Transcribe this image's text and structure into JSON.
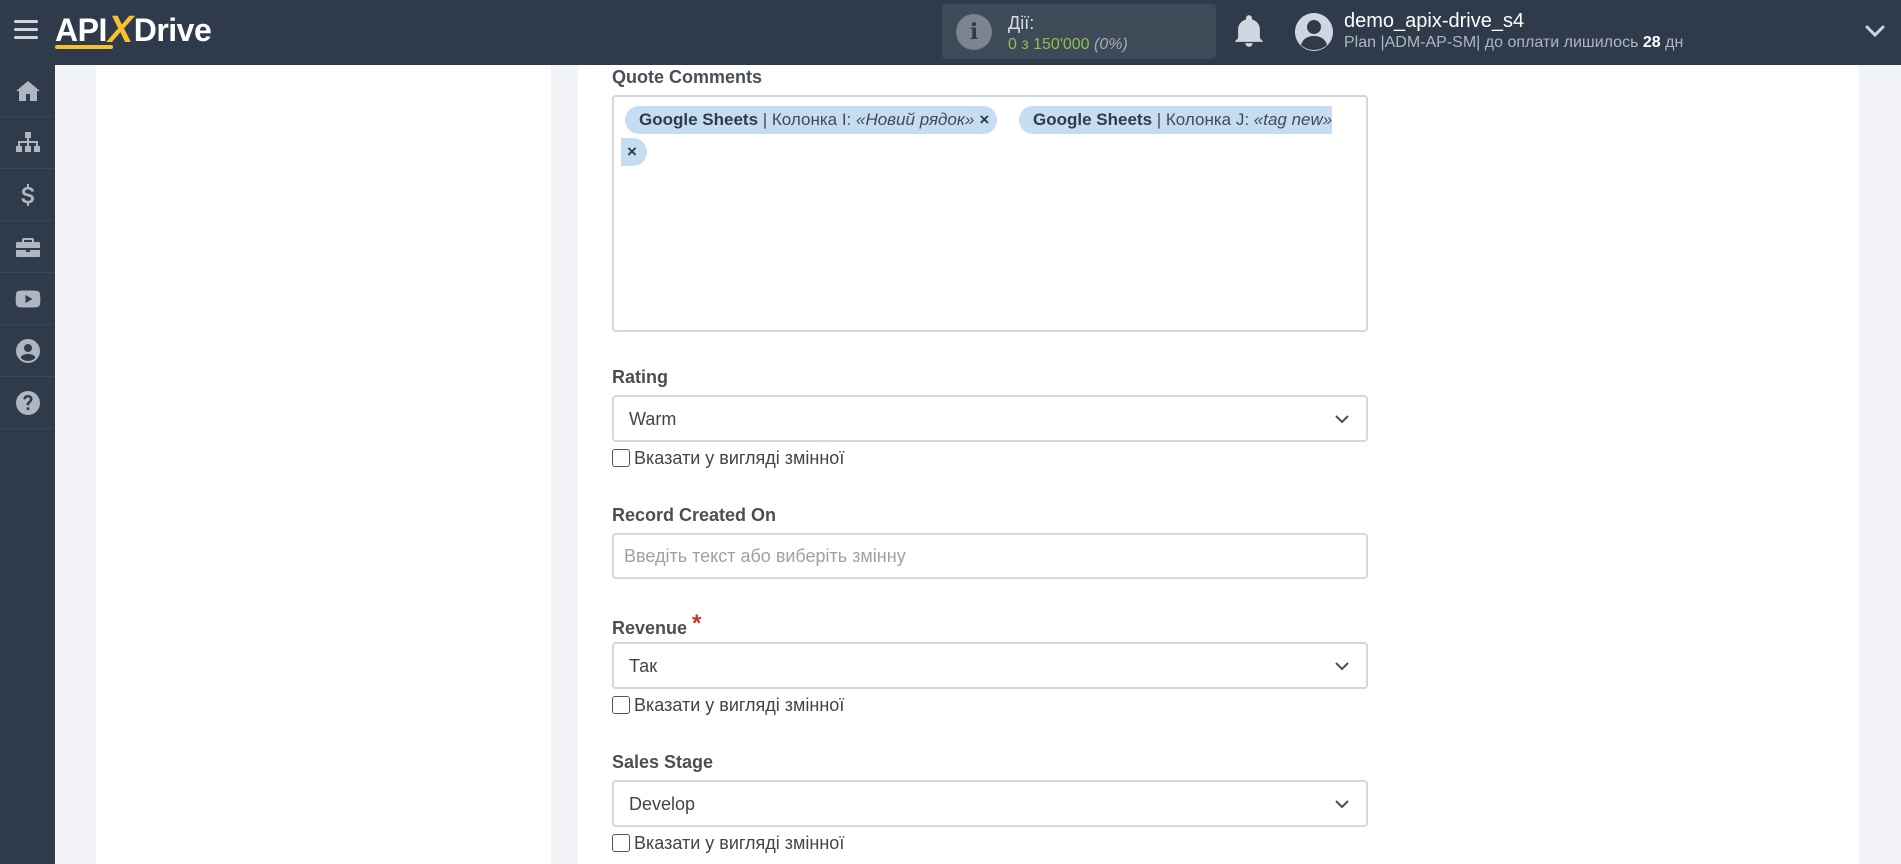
{
  "header": {
    "logo_left": "API",
    "logo_x": "X",
    "logo_right": "Drive",
    "actions_label": "Дії:",
    "actions_count": "0 з 150'000",
    "actions_percent": "(0%)",
    "username": "demo_apix-drive_s4",
    "plan_prefix": "Plan |ADM-AP-SM| до оплати лишилось",
    "plan_days": "28",
    "plan_suffix": "дн"
  },
  "sidebar": {
    "items": [
      {
        "icon": "home-icon"
      },
      {
        "icon": "sitemap-icon"
      },
      {
        "icon": "dollar-icon"
      },
      {
        "icon": "briefcase-icon"
      },
      {
        "icon": "youtube-icon"
      },
      {
        "icon": "user-circle-icon"
      },
      {
        "icon": "question-circle-icon"
      }
    ]
  },
  "form": {
    "quote_comments": {
      "label": "Quote Comments",
      "tags": [
        {
          "source": "Google Sheets",
          "sep": " | Колонка I: ",
          "value": "«Новий рядок»",
          "remove": "×"
        },
        {
          "source": "Google Sheets",
          "sep": " | Колонка J: ",
          "value": "«tag new»",
          "remove": "×"
        }
      ]
    },
    "rating": {
      "label": "Rating",
      "value": "Warm",
      "checkbox_label": "Вказати у вигляді змінної"
    },
    "record_created_on": {
      "label": "Record Created On",
      "value": "",
      "placeholder": "Введіть текст або виберіть змінну"
    },
    "revenue": {
      "label": "Revenue",
      "required_mark": "*",
      "value": "Так",
      "checkbox_label": "Вказати у вигляді змінної"
    },
    "sales_stage": {
      "label": "Sales Stage",
      "value": "Develop",
      "checkbox_label": "Вказати у вигляді змінної"
    }
  },
  "colors": {
    "topbar": "#2f3b4a",
    "accent_yellow": "#f6c12f",
    "counter_green": "#8bc34a",
    "tag_bg": "#c6dcf2",
    "required_red": "#c0392b"
  }
}
